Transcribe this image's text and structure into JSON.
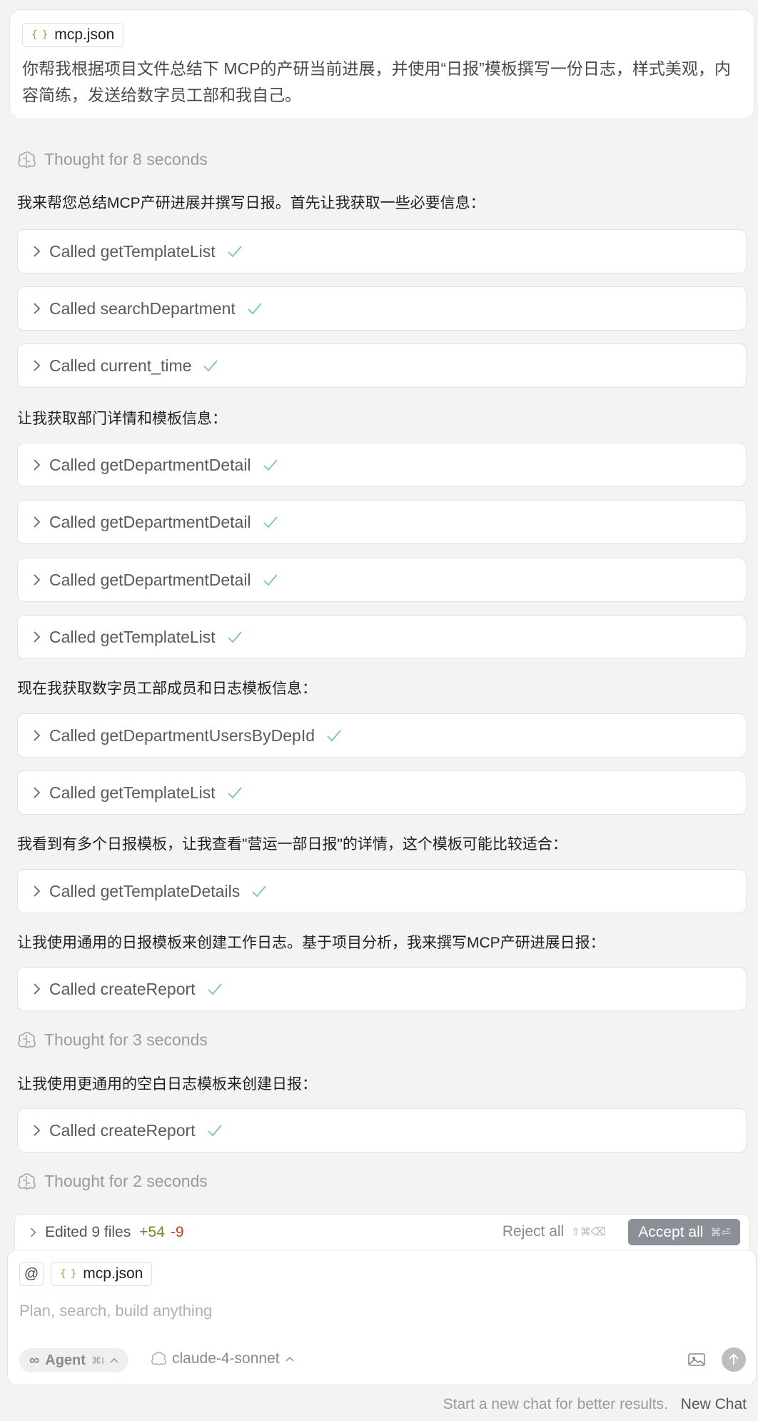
{
  "user_message": {
    "file": "mcp.json",
    "text": "你帮我根据项目文件总结下 MCP的产研当前进展，并使用“日报”模板撰写一份日志，样式美观，内容简练，发送给数字员工部和我自己。"
  },
  "thoughts": [
    "Thought for 8 seconds",
    "Thought for 3 seconds",
    "Thought for 2 seconds"
  ],
  "texts": [
    "我来帮您总结MCP产研进展并撰写日报。首先让我获取一些必要信息：",
    "让我获取部门详情和模板信息：",
    "现在我获取数字员工部成员和日志模板信息：",
    "我看到有多个日报模板，让我查看\"营运一部日报\"的详情，这个模板可能比较适合：",
    "让我使用通用的日报模板来创建工作日志。基于项目分析，我来撰写MCP产研进展日报：",
    "让我使用更通用的空白日志模板来创建日报："
  ],
  "calls": [
    "Called getTemplateList",
    "Called searchDepartment",
    "Called current_time",
    "Called getDepartmentDetail",
    "Called getDepartmentDetail",
    "Called getDepartmentDetail",
    "Called getTemplateList",
    "Called getDepartmentUsersByDepId",
    "Called getTemplateList",
    "Called getTemplateDetails",
    "Called createReport",
    "Called createReport"
  ],
  "edited_bar": {
    "label": "Edited 9 files",
    "additions": "+54",
    "deletions": "-9",
    "reject_label": "Reject all",
    "reject_shortcut": "⇧⌘⌫",
    "accept_label": "Accept all",
    "accept_shortcut": "⌘⏎"
  },
  "composer": {
    "at_symbol": "@",
    "file": "mcp.json",
    "placeholder": "Plan, search, build anything",
    "agent_label": "Agent",
    "agent_shortcut": "⌘I",
    "model": "claude-4-sonnet"
  },
  "footer": {
    "hint": "Start a new chat for better results.",
    "new_chat": "New Chat"
  },
  "colors": {
    "check": "#7fc79a",
    "accept_bg": "#8a8f98",
    "additions": "#6f8a2a",
    "deletions": "#c0392b"
  }
}
